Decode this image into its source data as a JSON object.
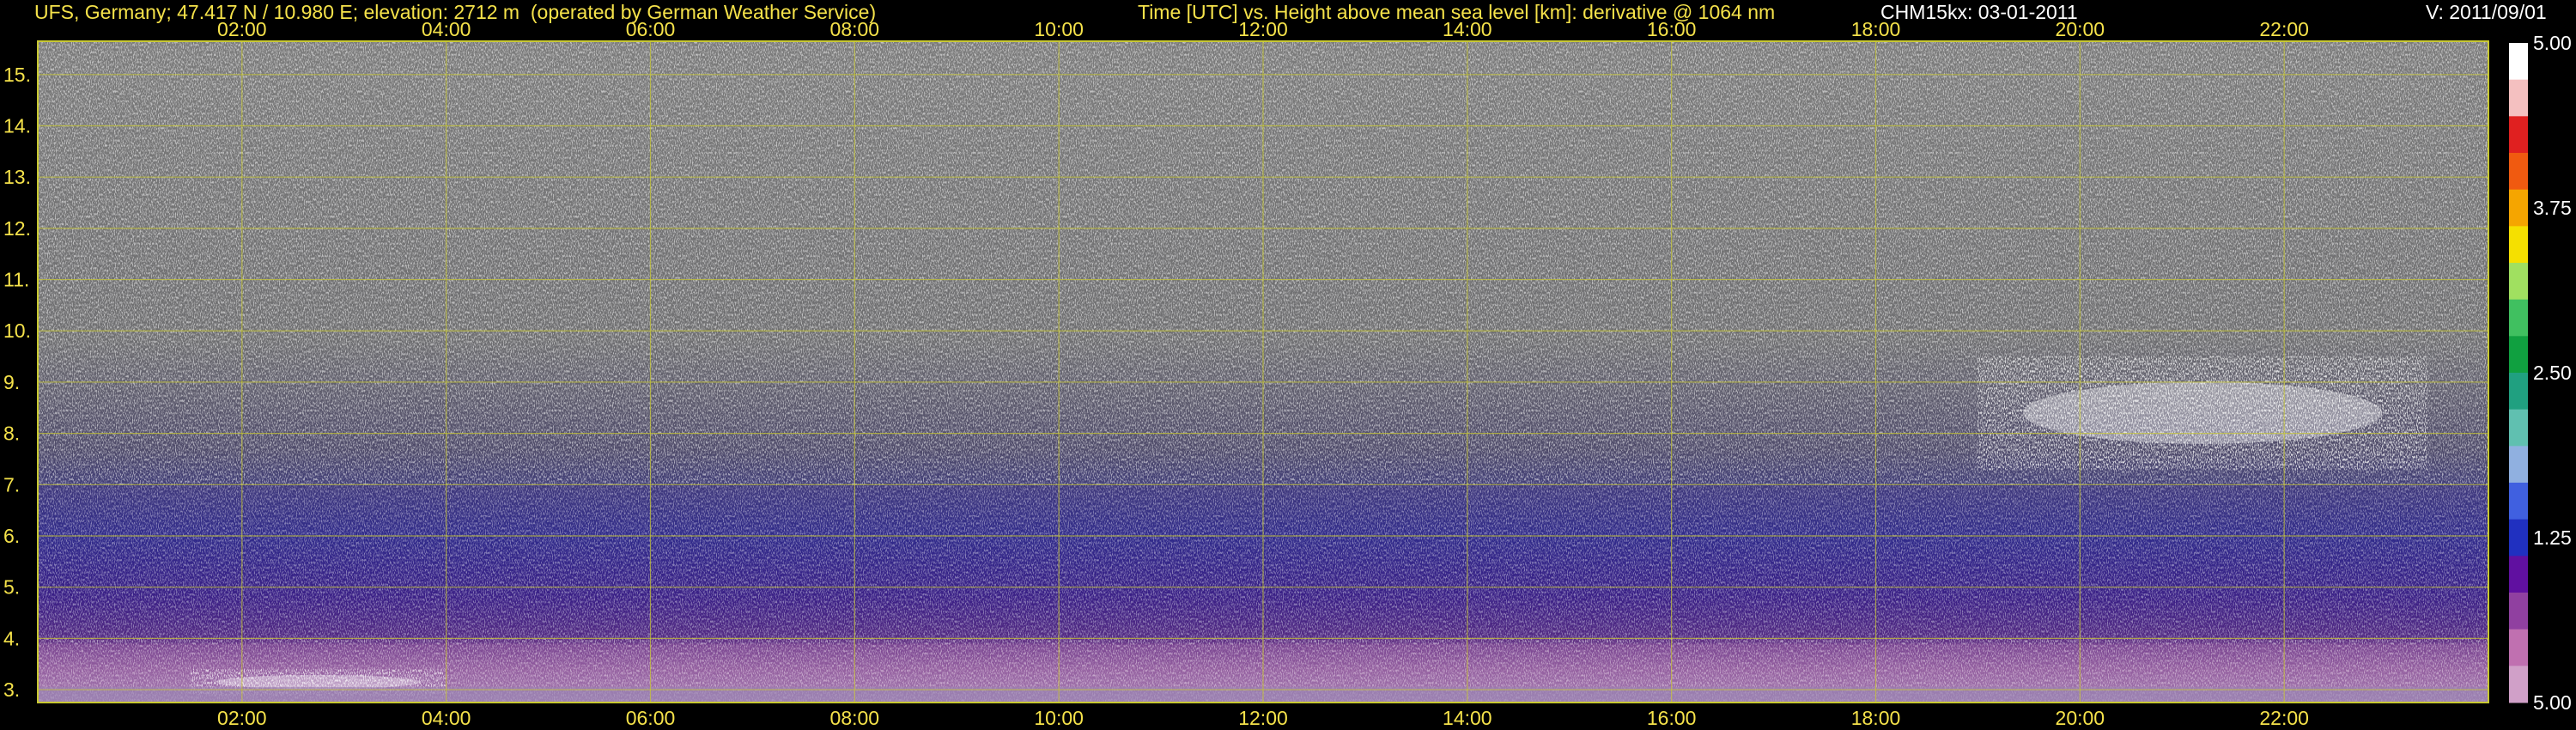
{
  "header": {
    "site": "UFS, Germany; 47.417 N / 10.980 E; elevation: 2712 m  (operated by German Weather Service)",
    "title": "Time [UTC] vs. Height above mean sea level [km]: derivative @ 1064 nm",
    "instrument": "CHM15kx: 03-01-2011",
    "version": "V: 2011/09/01"
  },
  "chart_data": {
    "type": "heatmap",
    "title": "Time [UTC] vs. Height above mean sea level [km]: derivative @ 1064 nm",
    "xlabel": "Time [UTC]",
    "ylabel": "Height above mean sea level [km]",
    "x_unit": "hours UTC",
    "xlim": [
      0,
      24
    ],
    "ylim": [
      2.75,
      15.65
    ],
    "x_ticks": [
      2,
      4,
      6,
      8,
      10,
      12,
      14,
      16,
      18,
      20,
      22
    ],
    "x_tick_labels": [
      "02:00",
      "04:00",
      "06:00",
      "08:00",
      "10:00",
      "12:00",
      "14:00",
      "16:00",
      "18:00",
      "20:00",
      "22:00"
    ],
    "y_ticks": [
      3,
      4,
      5,
      6,
      7,
      8,
      9,
      10,
      11,
      12,
      13,
      14,
      15
    ],
    "y_tick_labels": [
      "3.",
      "4.",
      "5.",
      "6.",
      "7.",
      "8.",
      "9.",
      "10.",
      "11.",
      "12.",
      "13.",
      "14.",
      "15."
    ],
    "grid": true,
    "grid_color": "#c8c832",
    "colorbar": {
      "tick_labels": [
        "5.00",
        "3.75",
        "2.50",
        "1.25",
        "5.00"
      ],
      "tick_values_top_to_bottom": [
        5.0,
        3.75,
        2.5,
        1.25,
        5.0
      ],
      "colors_top_to_bottom": [
        "#ffffff",
        "#f4c0c0",
        "#e02020",
        "#f05a10",
        "#f5a500",
        "#f5e000",
        "#a0e060",
        "#40c060",
        "#10a040",
        "#20a080",
        "#60c0b0",
        "#90b0e0",
        "#4060e0",
        "#2030c0",
        "#6010a0",
        "#9040a0",
        "#c070b0",
        "#d0a0c8"
      ]
    },
    "features": [
      {
        "name": "noise background",
        "y_range_km": [
          6.5,
          15.65
        ],
        "color": "#888888"
      },
      {
        "name": "blue-purple aerosol layer",
        "y_range_km": [
          4.0,
          7.0
        ],
        "color": "#3a2c8a"
      },
      {
        "name": "boundary layer top",
        "x_range_h": [
          0,
          24
        ],
        "y_range_km": [
          3.0,
          3.9
        ],
        "color": "#b070b0"
      },
      {
        "name": "cloud layer",
        "x_range_h": [
          19.0,
          23.4
        ],
        "y_range_km": [
          7.3,
          9.5
        ],
        "color": "#ffffff"
      },
      {
        "name": "low cloud",
        "x_range_h": [
          1.5,
          4.0
        ],
        "y_range_km": [
          2.9,
          3.4
        ],
        "color": "#ffffff"
      }
    ]
  }
}
